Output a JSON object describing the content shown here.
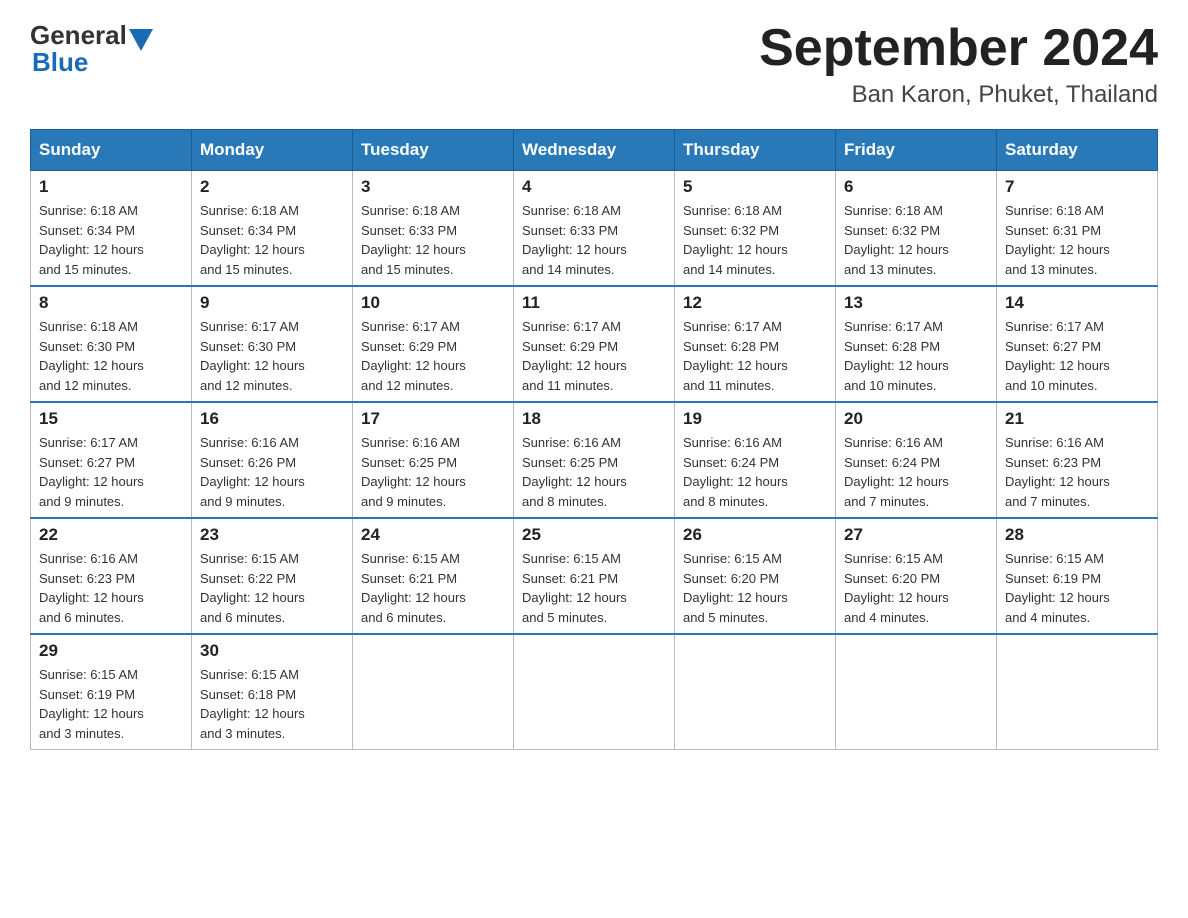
{
  "header": {
    "logo_general": "General",
    "logo_blue": "Blue",
    "month_title": "September 2024",
    "location": "Ban Karon, Phuket, Thailand"
  },
  "weekdays": [
    "Sunday",
    "Monday",
    "Tuesday",
    "Wednesday",
    "Thursday",
    "Friday",
    "Saturday"
  ],
  "weeks": [
    [
      {
        "day": "1",
        "sunrise": "6:18 AM",
        "sunset": "6:34 PM",
        "daylight": "12 hours and 15 minutes."
      },
      {
        "day": "2",
        "sunrise": "6:18 AM",
        "sunset": "6:34 PM",
        "daylight": "12 hours and 15 minutes."
      },
      {
        "day": "3",
        "sunrise": "6:18 AM",
        "sunset": "6:33 PM",
        "daylight": "12 hours and 15 minutes."
      },
      {
        "day": "4",
        "sunrise": "6:18 AM",
        "sunset": "6:33 PM",
        "daylight": "12 hours and 14 minutes."
      },
      {
        "day": "5",
        "sunrise": "6:18 AM",
        "sunset": "6:32 PM",
        "daylight": "12 hours and 14 minutes."
      },
      {
        "day": "6",
        "sunrise": "6:18 AM",
        "sunset": "6:32 PM",
        "daylight": "12 hours and 13 minutes."
      },
      {
        "day": "7",
        "sunrise": "6:18 AM",
        "sunset": "6:31 PM",
        "daylight": "12 hours and 13 minutes."
      }
    ],
    [
      {
        "day": "8",
        "sunrise": "6:18 AM",
        "sunset": "6:30 PM",
        "daylight": "12 hours and 12 minutes."
      },
      {
        "day": "9",
        "sunrise": "6:17 AM",
        "sunset": "6:30 PM",
        "daylight": "12 hours and 12 minutes."
      },
      {
        "day": "10",
        "sunrise": "6:17 AM",
        "sunset": "6:29 PM",
        "daylight": "12 hours and 12 minutes."
      },
      {
        "day": "11",
        "sunrise": "6:17 AM",
        "sunset": "6:29 PM",
        "daylight": "12 hours and 11 minutes."
      },
      {
        "day": "12",
        "sunrise": "6:17 AM",
        "sunset": "6:28 PM",
        "daylight": "12 hours and 11 minutes."
      },
      {
        "day": "13",
        "sunrise": "6:17 AM",
        "sunset": "6:28 PM",
        "daylight": "12 hours and 10 minutes."
      },
      {
        "day": "14",
        "sunrise": "6:17 AM",
        "sunset": "6:27 PM",
        "daylight": "12 hours and 10 minutes."
      }
    ],
    [
      {
        "day": "15",
        "sunrise": "6:17 AM",
        "sunset": "6:27 PM",
        "daylight": "12 hours and 9 minutes."
      },
      {
        "day": "16",
        "sunrise": "6:16 AM",
        "sunset": "6:26 PM",
        "daylight": "12 hours and 9 minutes."
      },
      {
        "day": "17",
        "sunrise": "6:16 AM",
        "sunset": "6:25 PM",
        "daylight": "12 hours and 9 minutes."
      },
      {
        "day": "18",
        "sunrise": "6:16 AM",
        "sunset": "6:25 PM",
        "daylight": "12 hours and 8 minutes."
      },
      {
        "day": "19",
        "sunrise": "6:16 AM",
        "sunset": "6:24 PM",
        "daylight": "12 hours and 8 minutes."
      },
      {
        "day": "20",
        "sunrise": "6:16 AM",
        "sunset": "6:24 PM",
        "daylight": "12 hours and 7 minutes."
      },
      {
        "day": "21",
        "sunrise": "6:16 AM",
        "sunset": "6:23 PM",
        "daylight": "12 hours and 7 minutes."
      }
    ],
    [
      {
        "day": "22",
        "sunrise": "6:16 AM",
        "sunset": "6:23 PM",
        "daylight": "12 hours and 6 minutes."
      },
      {
        "day": "23",
        "sunrise": "6:15 AM",
        "sunset": "6:22 PM",
        "daylight": "12 hours and 6 minutes."
      },
      {
        "day": "24",
        "sunrise": "6:15 AM",
        "sunset": "6:21 PM",
        "daylight": "12 hours and 6 minutes."
      },
      {
        "day": "25",
        "sunrise": "6:15 AM",
        "sunset": "6:21 PM",
        "daylight": "12 hours and 5 minutes."
      },
      {
        "day": "26",
        "sunrise": "6:15 AM",
        "sunset": "6:20 PM",
        "daylight": "12 hours and 5 minutes."
      },
      {
        "day": "27",
        "sunrise": "6:15 AM",
        "sunset": "6:20 PM",
        "daylight": "12 hours and 4 minutes."
      },
      {
        "day": "28",
        "sunrise": "6:15 AM",
        "sunset": "6:19 PM",
        "daylight": "12 hours and 4 minutes."
      }
    ],
    [
      {
        "day": "29",
        "sunrise": "6:15 AM",
        "sunset": "6:19 PM",
        "daylight": "12 hours and 3 minutes."
      },
      {
        "day": "30",
        "sunrise": "6:15 AM",
        "sunset": "6:18 PM",
        "daylight": "12 hours and 3 minutes."
      },
      null,
      null,
      null,
      null,
      null
    ]
  ],
  "labels": {
    "sunrise_prefix": "Sunrise: ",
    "sunset_prefix": "Sunset: ",
    "daylight_prefix": "Daylight: "
  }
}
